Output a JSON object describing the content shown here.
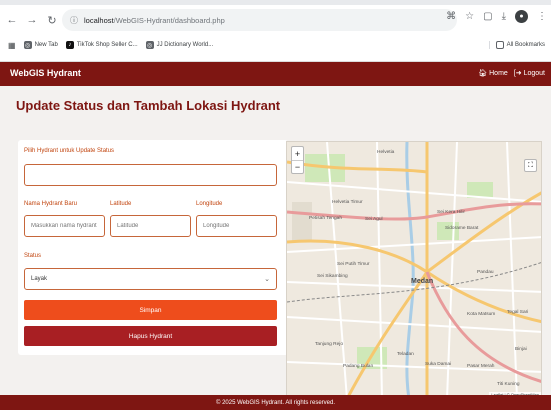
{
  "browser": {
    "url_host": "localhost",
    "url_path": "/WebGIS-Hydrant/dashboard.php",
    "bookmarks": [
      {
        "label": "New Tab",
        "icon": "globe-icon"
      },
      {
        "label": "TikTok Shop Seller C...",
        "icon": "tiktok-icon"
      },
      {
        "label": "JJ Dictionary World...",
        "icon": "globe-icon"
      }
    ],
    "all_bookmarks": "All Bookmarks"
  },
  "header": {
    "brand": "WebGIS Hydrant",
    "home": "Home",
    "logout": "Logout",
    "color": "#7e1612"
  },
  "page": {
    "title": "Update Status dan Tambah Lokasi Hydrant"
  },
  "form": {
    "select_label": "Pilih Hydrant untuk Update Status",
    "select_value": "",
    "name_label": "Nama Hydrant Baru",
    "name_placeholder": "Masukkan nama hydrant",
    "lat_label": "Latitude",
    "lat_placeholder": "Latitude",
    "lng_label": "Longitude",
    "lng_placeholder": "Longitude",
    "status_label": "Status",
    "status_value": "Layak",
    "save_label": "Simpan",
    "delete_label": "Hapus Hydrant",
    "save_color": "#ee4d1c",
    "delete_color": "#a81f23"
  },
  "map": {
    "zoom_in": "+",
    "zoom_out": "−",
    "labels": {
      "helvetia": "Helvetia",
      "helvetia_timur": "Helvetia Timur",
      "sei_sikambing": "Sei Sikambing",
      "sei_putih_timur": "Sei Putih Timur",
      "medan": "Medan",
      "petisah": "Petisah Tengah",
      "tanjung_rejo": "Tanjung Rejo",
      "padang_bulan": "Padang Bulan",
      "sidorame": "Sidorame Barat",
      "pandau": "Pandau",
      "kota_matsum": "Kota Matsum",
      "suka_damai": "Suka Damai",
      "pasar_merah": "Pasar Merah",
      "titi_kuning": "Titi Kuning",
      "binjai": "Binjai",
      "teladan": "Teladan",
      "tegal_sari": "Tegal Sari",
      "sei_agul": "Sei Agul",
      "sei_kera": "Sei Kera Hilir"
    },
    "attribution": "Leaflet | © OpenStreetMap"
  },
  "footer": {
    "text": "© 2025 WebGIS Hydrant. All rights reserved."
  }
}
